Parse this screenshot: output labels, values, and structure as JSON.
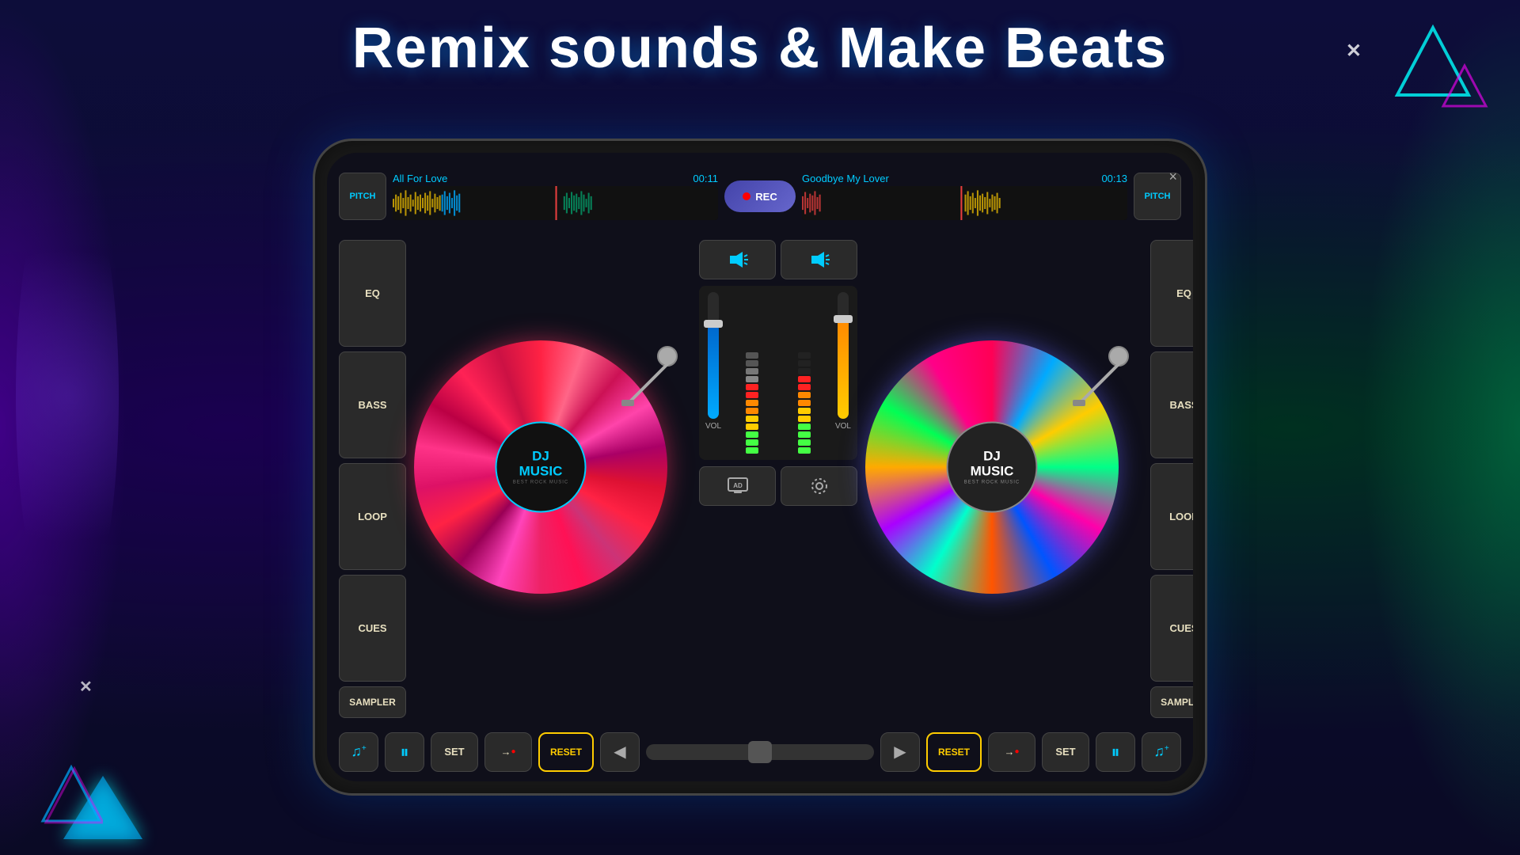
{
  "title": "Remix sounds & Make Beats",
  "background": {
    "color_left": "#1a0050",
    "color_right": "#003020",
    "base": "#0a0a2e"
  },
  "close_button": "×",
  "left_deck": {
    "track_name": "All For Love",
    "time": "00:11",
    "pitch_label": "PITCH",
    "eq_label": "EQ",
    "bass_label": "BASS",
    "loop_label": "LOOP",
    "cues_label": "CUES",
    "sampler_label": "SAMPLER",
    "vinyl_line1": "DJ",
    "vinyl_line2": "MUSIC",
    "vinyl_sub": "BEST ROCK MUSIC"
  },
  "right_deck": {
    "track_name": "Goodbye My Lover",
    "time": "00:13",
    "pitch_label": "PITCH",
    "eq_label": "EQ",
    "bass_label": "BASS",
    "loop_label": "LOOP",
    "cues_label": "CUES",
    "sampler_label": "SAMPLER",
    "vinyl_line1": "DJ",
    "vinyl_line2": "MUSIC",
    "vinyl_sub": "BEST ROCK MUSIC"
  },
  "center": {
    "rec_label": "REC",
    "vol_label": "VOL",
    "vol_label2": "VOL"
  },
  "transport_left": {
    "add_music": "♫",
    "pause": "⏸",
    "set": "SET",
    "arrow_dot": "→●",
    "reset": "RESET",
    "arrow_left": "◀"
  },
  "transport_right": {
    "arrow_right": "▶",
    "reset": "RESET",
    "arrow_dot": "→●",
    "set": "SET",
    "pause": "⏸",
    "add_music": "♫"
  }
}
